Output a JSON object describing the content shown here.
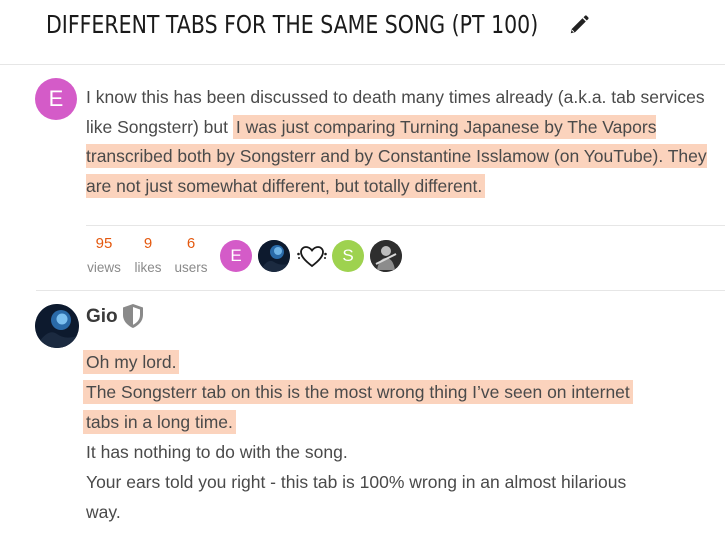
{
  "topic": {
    "title": "DIFFERENT TABS FOR THE SAME SONG (PT 100)",
    "edit_icon": "pencil-icon"
  },
  "first_post": {
    "avatar_letter": "E",
    "avatar_color": "#d45bc8",
    "plain_text": "I know this has been discussed to death many times already (a.k.a. tab services like Songsterr) but",
    "highlighted_text": "I was just comparing Turning Japanese by The Vapors transcribed both by Songsterr and by Constantine Isslamow (on YouTube). They are not just somewhat different, but totally different.",
    "stats": [
      {
        "value": "95",
        "label": "views"
      },
      {
        "value": "9",
        "label": "likes"
      },
      {
        "value": "6",
        "label": "users"
      }
    ],
    "participants": [
      {
        "letter": "E",
        "color": "#d45bc8"
      },
      {
        "letter": "",
        "color": "#0d1a2e"
      },
      {
        "letter": "",
        "color": "#ffffff"
      },
      {
        "letter": "S",
        "color": "#9ed24f"
      },
      {
        "letter": "",
        "color": "#3c3c3c"
      }
    ]
  },
  "second_post": {
    "username": "Gio",
    "badge_icon": "shield-icon",
    "lines": [
      {
        "text": "Oh my lord.",
        "highlight": true
      },
      {
        "text": "The Songsterr tab on this is the most wrong thing I’ve seen on internet",
        "highlight": true
      },
      {
        "text": "tabs in a long time.",
        "highlight": true
      },
      {
        "text": "It has nothing to do with the song.",
        "highlight": false
      },
      {
        "text": "Your ears told you right - this tab is 100% wrong in an almost hilarious",
        "highlight": false
      },
      {
        "text": "way.",
        "highlight": false
      }
    ]
  },
  "colors": {
    "highlight": "#fbd3bd",
    "stat_number": "#e4590f"
  }
}
